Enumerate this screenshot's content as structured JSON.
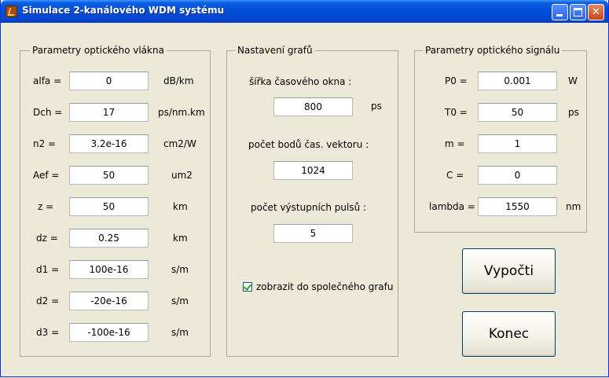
{
  "window": {
    "title": "Simulace 2-kanálového WDM systému"
  },
  "fiber_panel": {
    "legend": "Parametry optického vlákna",
    "rows": [
      {
        "label": "alfa =",
        "value": "0",
        "unit": "dB/km"
      },
      {
        "label": "Dch =",
        "value": "17",
        "unit": "ps/nm.km"
      },
      {
        "label": "n2 =",
        "value": "3.2e-16",
        "unit": "cm2/W"
      },
      {
        "label": "Aef =",
        "value": "50",
        "unit": "um2"
      },
      {
        "label": "z =",
        "value": "50",
        "unit": "km"
      },
      {
        "label": "dz =",
        "value": "0.25",
        "unit": "km"
      },
      {
        "label": "d1 =",
        "value": "100e-16",
        "unit": "s/m"
      },
      {
        "label": "d2 =",
        "value": "-20e-16",
        "unit": "s/m"
      },
      {
        "label": "d3 =",
        "value": "-100e-16",
        "unit": "s/m"
      }
    ]
  },
  "graph_panel": {
    "legend": "Nastavení grafů",
    "time_window_label": "šířka časového okna :",
    "time_window_value": "800",
    "time_window_unit": "ps",
    "points_label": "počet bodů čas. vektoru :",
    "points_value": "1024",
    "pulses_label": "počet výstupních pulsů :",
    "pulses_value": "5",
    "checkbox_label": "zobrazit do společného grafu",
    "checkbox_checked": true
  },
  "signal_panel": {
    "legend": "Parametry optického signálu",
    "rows": [
      {
        "label": "P0 =",
        "value": "0.001",
        "unit": "W"
      },
      {
        "label": "T0 =",
        "value": "50",
        "unit": "ps"
      },
      {
        "label": "m =",
        "value": "1",
        "unit": ""
      },
      {
        "label": "C =",
        "value": "0",
        "unit": ""
      },
      {
        "label": "lambda =",
        "value": "1550",
        "unit": "nm"
      }
    ]
  },
  "buttons": {
    "compute": "Vypočti",
    "close": "Konec"
  }
}
